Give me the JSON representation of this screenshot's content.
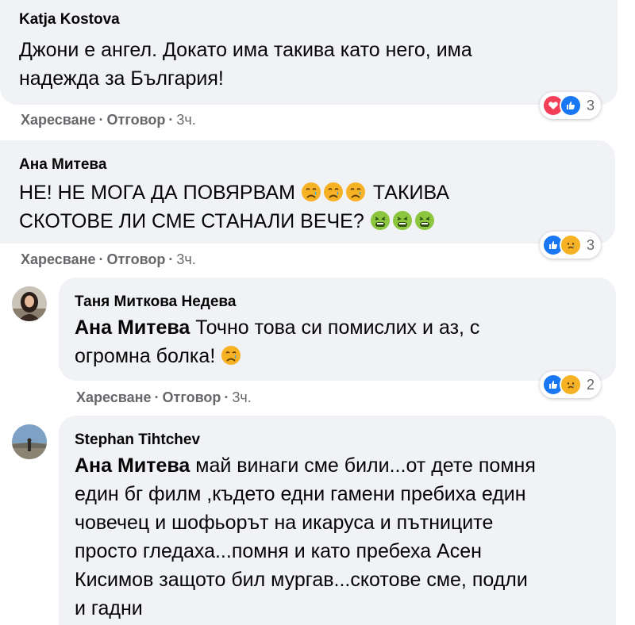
{
  "comments": [
    {
      "author": "Katja Kostova",
      "text_lines": [
        "Джони е ангел. Докато има такива като него, има",
        "надежда за България!"
      ],
      "actions": {
        "like": "Харесване",
        "reply": "Отговор",
        "time": "3ч."
      },
      "reactions": {
        "icons": [
          "heart",
          "like"
        ],
        "count": "3"
      }
    },
    {
      "author": "Ана Митева",
      "line1_text": "НЕ! НЕ МОГА ДА ПОВЯРВАМ",
      "line1_emoji": [
        "crying-face",
        "crying-face",
        "crying-face"
      ],
      "line1_tail": "ТАКИВА",
      "line2_text": "СКОТОВЕ ЛИ СМЕ СТАНАЛИ ВЕЧЕ?",
      "line2_emoji": [
        "nauseated-face",
        "nauseated-face",
        "nauseated-face"
      ],
      "actions": {
        "like": "Харесване",
        "reply": "Отговор",
        "time": "3ч."
      },
      "reactions": {
        "icons": [
          "like",
          "sad"
        ],
        "count": "3"
      }
    }
  ],
  "replies": [
    {
      "author": "Таня Миткова Недева",
      "mention": "Ана Митева",
      "line1": "Точно това си помислих и аз, с",
      "line2": "огромна болка!",
      "line2_emoji": [
        "crying-face"
      ],
      "actions": {
        "like": "Харесване",
        "reply": "Отговор",
        "time": "3ч."
      },
      "reactions": {
        "icons": [
          "like",
          "sad"
        ],
        "count": "2"
      }
    },
    {
      "author": "Stephan Tihtchev",
      "mention": "Ана Митева",
      "line1": "май винаги сме били...от дете помня",
      "lines": [
        "един бг филм ,където едни гамени пребиха един",
        "човечец и шофьорът на икаруса и пътниците",
        "просто гледаха...помня и като пребеха Асен",
        "Кисимов защото бил мургав...скотове сме, подли",
        "и гадни"
      ]
    }
  ],
  "colors": {
    "bubble": "#f0f2f5",
    "meta": "#65676b",
    "like_blue": "#1877f2",
    "heart_red": "#f33e58",
    "emoji_yellow": "#f7b125"
  }
}
